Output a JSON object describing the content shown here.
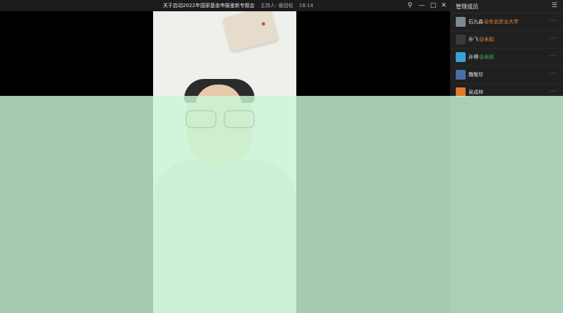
{
  "window": {
    "meeting_title": "关于启动2022年国家基金申报鉴新专题会",
    "host": "主持人: 垂固松",
    "time": "18:14",
    "controls": {
      "pin": "⚲",
      "minimize": "—",
      "maximize": "□",
      "close": "✕"
    }
  },
  "panel": {
    "title": "管理成员",
    "icon": "menu-list-icon",
    "members": [
      {
        "name": "石九森",
        "org": "@东北农业大学",
        "org_color": "#f08a3a",
        "avatar_color": "#7b8a93",
        "more": "···"
      },
      {
        "name": "孙飞",
        "org": "@未知",
        "org_color": "#f08a3a",
        "avatar_color": "#3a3a3a",
        "more": "···"
      },
      {
        "name": "孙博",
        "org": "@未知",
        "org_color": "#39c26b",
        "avatar_color": "#3aa0d8",
        "more": "···"
      },
      {
        "name": "魏敬珍",
        "org": "",
        "org_color": "#f08a3a",
        "avatar_color": "#4a6fa8",
        "more": "···"
      },
      {
        "name": "吴成林",
        "org": "",
        "org_color": "#f08a3a",
        "avatar_color": "#e07a2c",
        "more": "···"
      }
    ]
  },
  "colors": {
    "background": "#000000",
    "panel": "#202020",
    "overlay": "#c9f7d6"
  }
}
